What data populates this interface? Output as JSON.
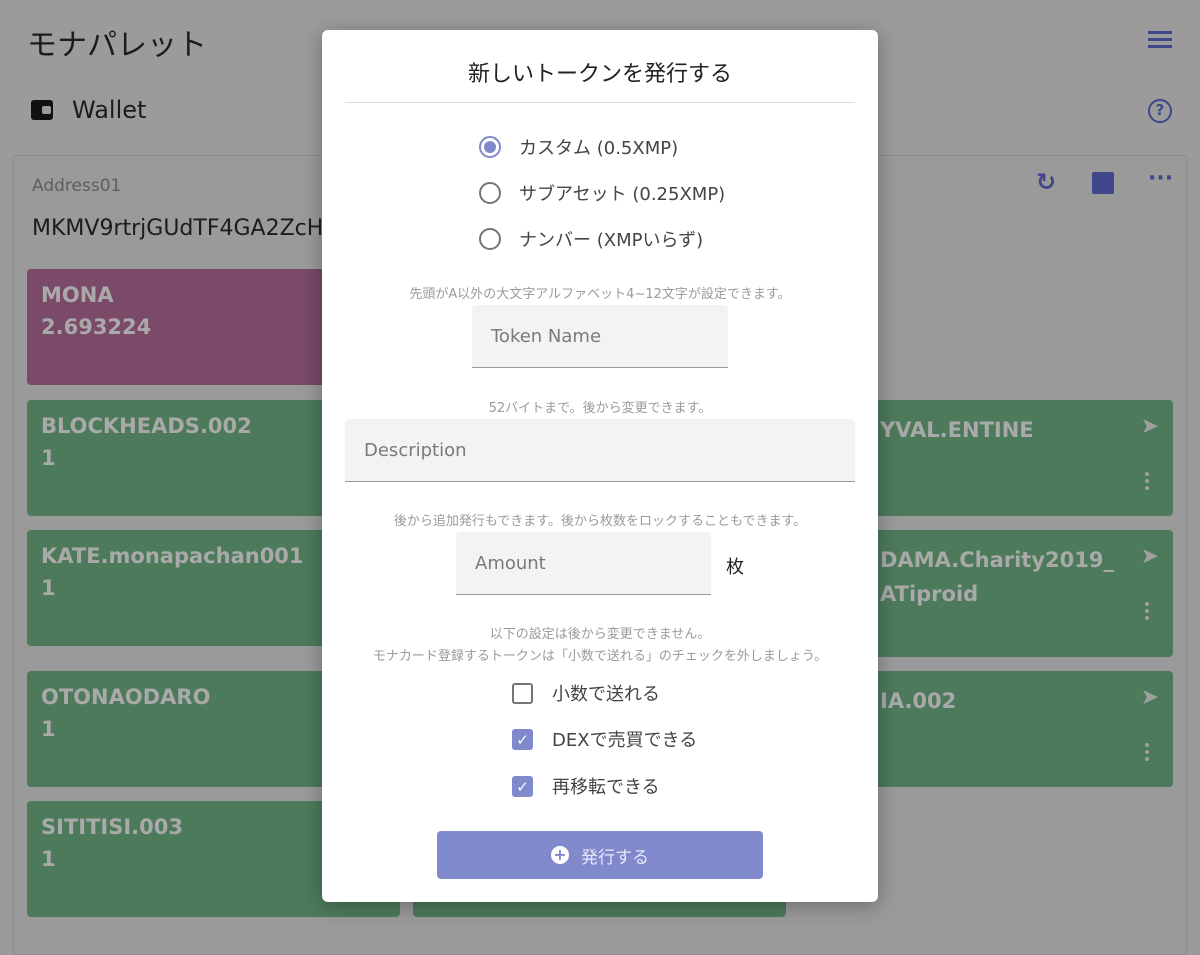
{
  "app": {
    "title": "モナパレット",
    "menu_icon": "hamburger-menu-icon"
  },
  "section": {
    "title": "Wallet",
    "icon": "wallet-icon",
    "help_icon": "help-circle-icon"
  },
  "address": {
    "label": "Address01",
    "value": "MKMV9rtrjGUdTF4GA2ZcH",
    "actions": [
      "refresh-icon",
      "image-icon",
      "more-horiz-icon"
    ]
  },
  "tokens": [
    {
      "name": "MONA",
      "amount": "2.693224"
    },
    {
      "name": "BLOCKHEADS.002",
      "amount": "1"
    },
    {
      "name": "KATE.monapachan001",
      "amount": "1"
    },
    {
      "name": "OTONAODARO",
      "amount": "1"
    },
    {
      "name": "SITITISI.003",
      "amount": "1"
    }
  ],
  "partial_tokens": [
    {
      "name_line1": "YVAL.ENTINE",
      "name_line2": ""
    },
    {
      "name_line1": "DAMA.Charity2019_",
      "name_line2": "ATiproid"
    },
    {
      "name_line1": "IA.002",
      "name_line2": ""
    }
  ],
  "colors": {
    "mona_card": "#7a4a68",
    "token_card": "#4d7a5b",
    "accent": "#7f89cc"
  },
  "modal": {
    "title": "新しいトークンを発行する",
    "types": [
      {
        "label": "カスタム (0.5XMP)",
        "selected": true
      },
      {
        "label": "サブアセット (0.25XMP)",
        "selected": false
      },
      {
        "label": "ナンバー (XMPいらず)",
        "selected": false
      }
    ],
    "name_hint": "先頭がA以外の大文字アルファベット4~12文字が設定できます。",
    "name_placeholder": "Token Name",
    "desc_hint": "52バイトまで。後から変更できます。",
    "desc_placeholder": "Description",
    "amount_hint": "後から追加発行もできます。後から枚数をロックすることもできます。",
    "amount_placeholder": "Amount",
    "amount_unit": "枚",
    "settings_hint1": "以下の設定は後から変更できません。",
    "settings_hint2": "モナカード登録するトークンは「小数で送れる」のチェックを外しましょう。",
    "options": [
      {
        "label": "小数で送れる",
        "checked": false
      },
      {
        "label": "DEXで売買できる",
        "checked": true
      },
      {
        "label": "再移転できる",
        "checked": true
      }
    ],
    "submit_label": "発行する"
  }
}
